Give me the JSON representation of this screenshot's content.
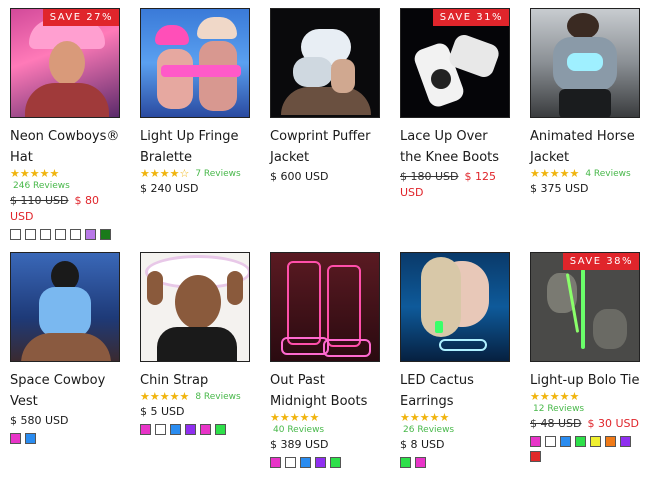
{
  "products": [
    {
      "title": "Neon Cowboys® Hat",
      "badge": "SAVE 27%",
      "stars": "★★★★★",
      "reviews": "246 Reviews",
      "old_price": "$ 110 USD",
      "price": "$ 80 USD",
      "swatches": [
        "#ffffff",
        "#ffffff",
        "#ffffff",
        "#ffffff",
        "#ffffff",
        "#b878e8",
        "#1a7a1a"
      ]
    },
    {
      "title": "Light Up Fringe Bralette",
      "stars": "★★★★☆",
      "reviews": "7 Reviews",
      "price": "$ 240 USD"
    },
    {
      "title": "Cowprint Puffer Jacket",
      "price": "$ 600 USD"
    },
    {
      "title": "Lace Up Over the Knee Boots",
      "badge": "SAVE 31%",
      "old_price": "$ 180 USD",
      "price": "$ 125 USD"
    },
    {
      "title": "Animated Horse Jacket",
      "stars": "★★★★★",
      "reviews": "4 Reviews",
      "price": "$ 375 USD"
    },
    {
      "title": "Space Cowboy Vest",
      "price": "$ 580 USD",
      "swatches": [
        "#e834c8",
        "#2a8cf0"
      ]
    },
    {
      "title": "Chin Strap",
      "stars": "★★★★★",
      "reviews": "8 Reviews",
      "price": "$ 5 USD",
      "swatches": [
        "#e834c8",
        "#ffffff",
        "#2a8cf0",
        "#8f2ff0",
        "#e834c8",
        "#2ee04a"
      ]
    },
    {
      "title": "Out Past Midnight Boots",
      "stars": "★★★★★",
      "reviews": "40 Reviews",
      "price": "$ 389 USD",
      "swatches": [
        "#e834c8",
        "#ffffff",
        "#2a8cf0",
        "#8f2ff0",
        "#2ee04a"
      ]
    },
    {
      "title": "LED Cactus Earrings",
      "stars": "★★★★★",
      "reviews": "26 Reviews",
      "price": "$ 8 USD",
      "swatches": [
        "#2ee04a",
        "#e834c8"
      ]
    },
    {
      "title": "Light-up Bolo Tie",
      "badge": "SAVE 38%",
      "stars": "★★★★★",
      "reviews": "12 Reviews",
      "old_price": "$ 48 USD",
      "price": "$ 30 USD",
      "swatches": [
        "#e834c8",
        "#ffffff",
        "#2a8cf0",
        "#2ee04a",
        "#f0f030",
        "#f07a18",
        "#8f2ff0",
        "#e02828"
      ]
    }
  ]
}
